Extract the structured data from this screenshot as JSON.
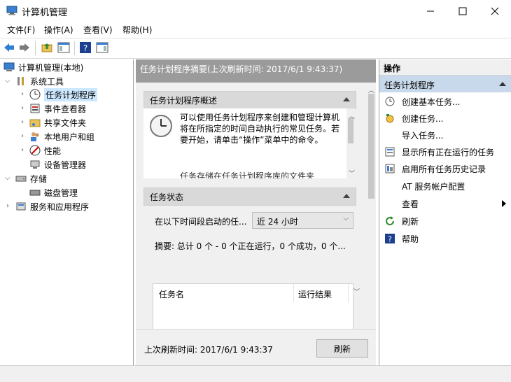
{
  "window": {
    "title": "计算机管理",
    "minimize": "—",
    "maximize": "☐",
    "close": "✕"
  },
  "menu": [
    "文件(F)",
    "操作(A)",
    "查看(V)",
    "帮助(H)"
  ],
  "tree": {
    "root": "计算机管理(本地)",
    "system_tools": "系统工具",
    "task_scheduler": "任务计划程序",
    "event_viewer": "事件查看器",
    "shared_folders": "共享文件夹",
    "local_users": "本地用户和组",
    "performance": "性能",
    "device_manager": "设备管理器",
    "storage": "存储",
    "disk_management": "磁盘管理",
    "services_apps": "服务和应用程序"
  },
  "center": {
    "header": "任务计划程序摘要(上次刷新时间: 2017/6/1 9:43:37)",
    "overview_title": "任务计划程序概述",
    "overview_text": "可以使用任务计划程序来创建和管理计算机将在所指定的时间自动执行的常见任务。若要开始，请单击“操作”菜单中的命令。",
    "overview_text2": "任务存储在任务计划程序库的文件夹",
    "status_title": "任务状态",
    "period_label": "在以下时间段启动的任...",
    "period_value": "近 24 小时",
    "summary": "摘要: 总计 0 个 - 0 个正在运行，0 个成功，0 个...",
    "col_task_name": "任务名",
    "col_result": "运行结果",
    "last_refresh": "上次刷新时间: 2017/6/1 9:43:37",
    "refresh_button": "刷新"
  },
  "actions": {
    "header": "操作",
    "group": "任务计划程序",
    "items": [
      "创建基本任务...",
      "创建任务...",
      "导入任务...",
      "显示所有正在运行的任务",
      "启用所有任务历史记录",
      "AT 服务帐户配置",
      "查看",
      "刷新",
      "帮助"
    ]
  },
  "colors": {
    "accent": "#cce8ff",
    "section_bg": "#d9d9d9",
    "header_gray": "#9b9b9b",
    "action_group": "#c9d9ec"
  }
}
